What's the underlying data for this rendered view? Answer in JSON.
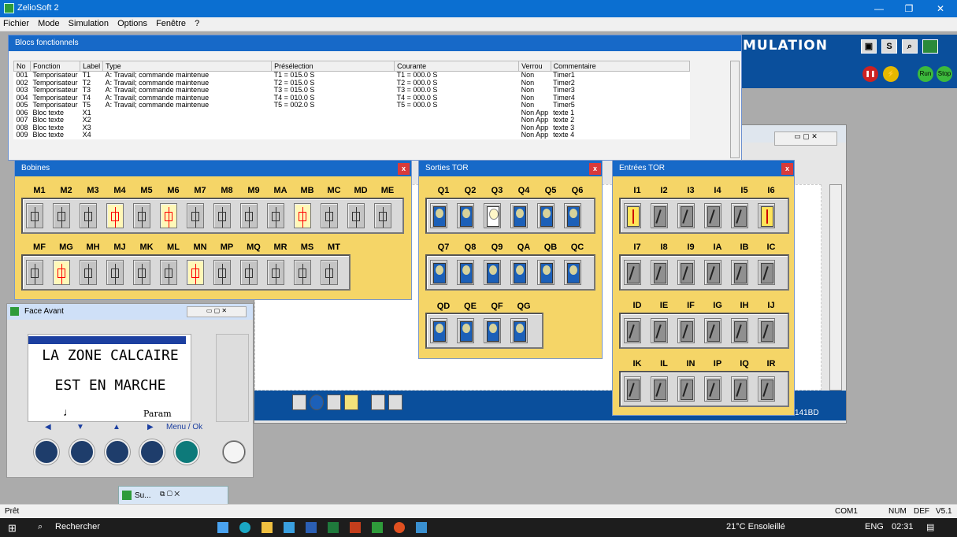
{
  "app": {
    "title": "ZelioSoft 2",
    "menu": [
      "Fichier",
      "Mode",
      "Simulation",
      "Options",
      "Fenêtre",
      "?"
    ]
  },
  "sim": {
    "word": "MULATION",
    "btn_s": "S",
    "run": "Run",
    "stop": "Stop"
  },
  "blocs": {
    "title": "Blocs fonctionnels",
    "columns": [
      "No",
      "Fonction",
      "Label",
      "Type",
      "Présélection",
      "Courante",
      "Verrou",
      "Commentaire"
    ],
    "rows": [
      [
        "001",
        "Temporisateur",
        "T1",
        "A: Travail; commande maintenue",
        "T1 = 015.0 S",
        "T1 = 000.0 S",
        "Non",
        "Timer1"
      ],
      [
        "002",
        "Temporisateur",
        "T2",
        "A: Travail; commande maintenue",
        "T2 = 015.0 S",
        "T2 = 000.0 S",
        "Non",
        "Timer2"
      ],
      [
        "003",
        "Temporisateur",
        "T3",
        "A: Travail; commande maintenue",
        "T3 = 015.0 S",
        "T3 = 000.0 S",
        "Non",
        "Timer3"
      ],
      [
        "004",
        "Temporisateur",
        "T4",
        "A: Travail; commande maintenue",
        "T4 = 010.0 S",
        "T4 = 000.0 S",
        "Non",
        "Timer4"
      ],
      [
        "005",
        "Temporisateur",
        "T5",
        "A: Travail; commande maintenue",
        "T5 = 002.0 S",
        "T5 = 000.0 S",
        "Non",
        "Timer5"
      ],
      [
        "006",
        "Bloc texte",
        "X1",
        "",
        "",
        "",
        "Non App",
        "texte 1"
      ],
      [
        "007",
        "Bloc texte",
        "X2",
        "",
        "",
        "",
        "Non App",
        "texte 2"
      ],
      [
        "008",
        "Bloc texte",
        "X3",
        "",
        "",
        "",
        "Non App",
        "texte 3"
      ],
      [
        "009",
        "Bloc texte",
        "X4",
        "",
        "",
        "",
        "Non App",
        "texte 4"
      ]
    ]
  },
  "bobines": {
    "title": "Bobines",
    "row1": [
      "M1",
      "M2",
      "M3",
      "M4",
      "M5",
      "M6",
      "M7",
      "M8",
      "M9",
      "MA",
      "MB",
      "MC",
      "MD",
      "ME"
    ],
    "row1_on": [
      false,
      false,
      false,
      true,
      false,
      true,
      false,
      false,
      false,
      false,
      true,
      false,
      false,
      false
    ],
    "row2": [
      "MF",
      "MG",
      "MH",
      "MJ",
      "MK",
      "ML",
      "MN",
      "MP",
      "MQ",
      "MR",
      "MS",
      "MT"
    ],
    "row2_on": [
      false,
      true,
      false,
      false,
      false,
      false,
      true,
      false,
      false,
      false,
      false,
      false
    ]
  },
  "sorties": {
    "title": "Sorties TOR",
    "row1": [
      "Q1",
      "Q2",
      "Q3",
      "Q4",
      "Q5",
      "Q6"
    ],
    "row1_on": [
      false,
      false,
      true,
      false,
      false,
      false
    ],
    "row2": [
      "Q7",
      "Q8",
      "Q9",
      "QA",
      "QB",
      "QC"
    ],
    "row2_on": [
      false,
      false,
      false,
      false,
      false,
      false
    ],
    "row3": [
      "QD",
      "QE",
      "QF",
      "QG"
    ],
    "row3_on": [
      false,
      false,
      false,
      false
    ]
  },
  "entrees": {
    "title": "Entrées TOR",
    "row1": [
      "I1",
      "I2",
      "I3",
      "I4",
      "I5",
      "I6"
    ],
    "row1_on": [
      true,
      false,
      false,
      false,
      false,
      true
    ],
    "row2": [
      "I7",
      "I8",
      "I9",
      "IA",
      "IB",
      "IC"
    ],
    "row2_on": [
      false,
      false,
      false,
      false,
      false,
      false
    ],
    "row3": [
      "ID",
      "IE",
      "IF",
      "IG",
      "IH",
      "IJ"
    ],
    "row3_on": [
      false,
      false,
      false,
      false,
      false,
      false
    ],
    "row4": [
      "IK",
      "IL",
      "IN",
      "IP",
      "IQ",
      "IR"
    ],
    "row4_on": [
      false,
      false,
      false,
      false,
      false,
      false
    ]
  },
  "face": {
    "title": "Face Avant",
    "line1": "LA ZONE CALCAIRE",
    "line2": "EST EN MARCHE",
    "param": "Param",
    "menu_ok": "Menu / Ok"
  },
  "bgwin": {
    "ref": "141BD"
  },
  "minwin": {
    "title": "Su..."
  },
  "status": {
    "left": "Prêt",
    "com": "COM1",
    "num": "NUM",
    "def": "DEF",
    "ver": "V5.1"
  },
  "taskbar": {
    "search": "Rechercher",
    "weather": "21°C Ensoleillé",
    "lang": "ENG",
    "time": "02:31"
  }
}
